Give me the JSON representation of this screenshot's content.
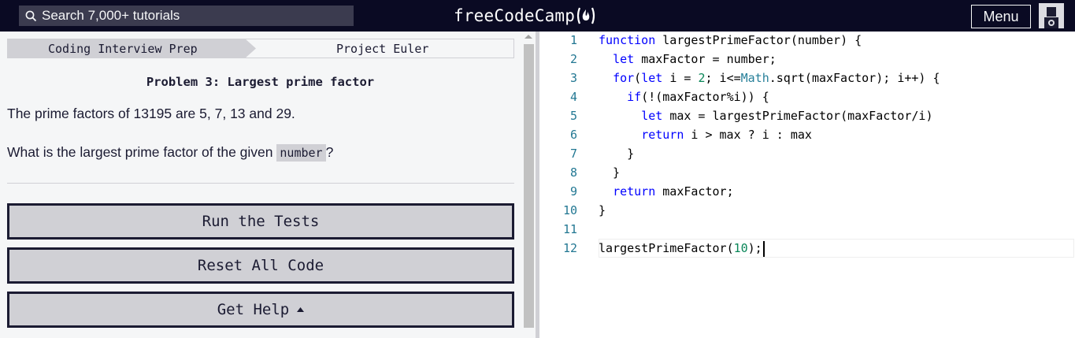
{
  "nav": {
    "search_placeholder": "Search 7,000+ tutorials",
    "logo_text": "freeCodeCamp",
    "logo_icon": "flame-icon",
    "menu_label": "Menu",
    "avatar_icon": "user-avatar-icon"
  },
  "challenge": {
    "breadcrumbs": [
      "Coding Interview Prep",
      "Project Euler"
    ],
    "title": "Problem 3: Largest prime factor",
    "paragraph1": "The prime factors of 13195 are 5, 7, 13 and 29.",
    "paragraph2_before": "What is the largest prime factor of the given ",
    "paragraph2_code": "number",
    "paragraph2_after": "?",
    "buttons": {
      "run": "Run the Tests",
      "reset": "Reset All Code",
      "help": "Get Help"
    },
    "help_caret_icon": "caret-up-icon"
  },
  "editor": {
    "line_numbers": [
      "1",
      "2",
      "3",
      "4",
      "5",
      "6",
      "7",
      "8",
      "9",
      "10",
      "11",
      "12"
    ],
    "lines": [
      "function largestPrimeFactor(number) {",
      "  let maxFactor = number;",
      "  for(let i = 2; i<=Math.sqrt(maxFactor); i++) {",
      "    if(!(maxFactor%i)) {",
      "      let max = largestPrimeFactor(maxFactor/i)",
      "      return i > max ? i : max",
      "    }",
      "  }",
      "  return maxFactor;",
      "}",
      "",
      "largestPrimeFactor(10);"
    ],
    "active_line": 12
  },
  "colors": {
    "nav_bg": "#0a0a23",
    "pane_bg": "#f5f6f7",
    "button_bg": "#d0d0d5",
    "text_dark": "#1b1b32",
    "keyword": "#0000ff",
    "number": "#098658",
    "type": "#267f99",
    "line_number": "#237893"
  }
}
